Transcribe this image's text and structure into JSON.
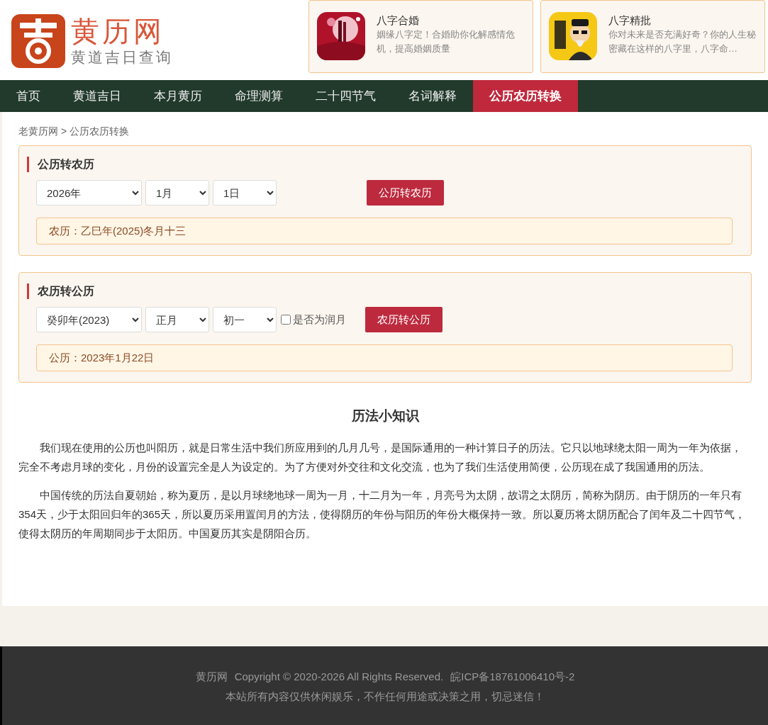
{
  "logo": {
    "title": "黄历网",
    "subtitle": "黄道吉日查询"
  },
  "promos": [
    {
      "title": "八字合婚",
      "text": "姻缘八字定！合婚助你化解感情危机，提高婚姻质量"
    },
    {
      "title": "八字精批",
      "text": "你对未来是否充满好奇？你的人生秘密藏在这样的八字里，八字命…"
    }
  ],
  "nav": [
    {
      "label": "首页",
      "selected": false
    },
    {
      "label": "黄道吉日",
      "selected": false
    },
    {
      "label": "本月黄历",
      "selected": false
    },
    {
      "label": "命理测算",
      "selected": false
    },
    {
      "label": "二十四节气",
      "selected": false
    },
    {
      "label": "名词解释",
      "selected": false
    },
    {
      "label": "公历农历转换",
      "selected": true
    }
  ],
  "breadcrumb": "老黄历网 > 公历农历转换",
  "converters": [
    {
      "title": "公历转农历",
      "selects": [
        "2026年",
        "1月",
        "1日"
      ],
      "button": "公历转农历",
      "result": "农历：乙巳年(2025)冬月十三"
    },
    {
      "title": "农历转公历",
      "selects": [
        "癸卯年(2023)",
        "正月",
        "初一"
      ],
      "leap": {
        "label": "是否为润月",
        "checked": false
      },
      "button": "农历转公历",
      "result": "公历：2023年1月22日"
    }
  ],
  "knowledge": {
    "title": "历法小知识",
    "paragraphs": [
      "我们现在使用的公历也叫阳历，就是日常生活中我们所应用到的几月几号，是国际通用的一种计算日子的历法。它只以地球绕太阳一周为一年为依据，完全不考虑月球的变化，月份的设置完全是人为设定的。为了方便对外交往和文化交流，也为了我们生活使用简便，公历现在成了我国通用的历法。",
      "中国传统的历法自夏朝始，称为夏历，是以月球绕地球一周为一月，十二月为一年，月亮号为太阴，故谓之太阴历，简称为阴历。由于阴历的一年只有354天，少于太阳回归年的365天，所以夏历采用置闰月的方法，使得阴历的年份与阳历的年份大概保持一致。所以夏历将太阴历配合了闰年及二十四节气，使得太阴历的年周期同步于太阳历。中国夏历其实是阴阳合历。"
    ]
  },
  "footer": {
    "site": "黄历网",
    "copyright": "Copyright © 2020-2026 All Rights Reserved.",
    "icp": "皖ICP备18761006410号-2",
    "disclaimer": "本站所有内容仅供休闲娱乐，不作任何用途或决策之用，切忌迷信！"
  }
}
